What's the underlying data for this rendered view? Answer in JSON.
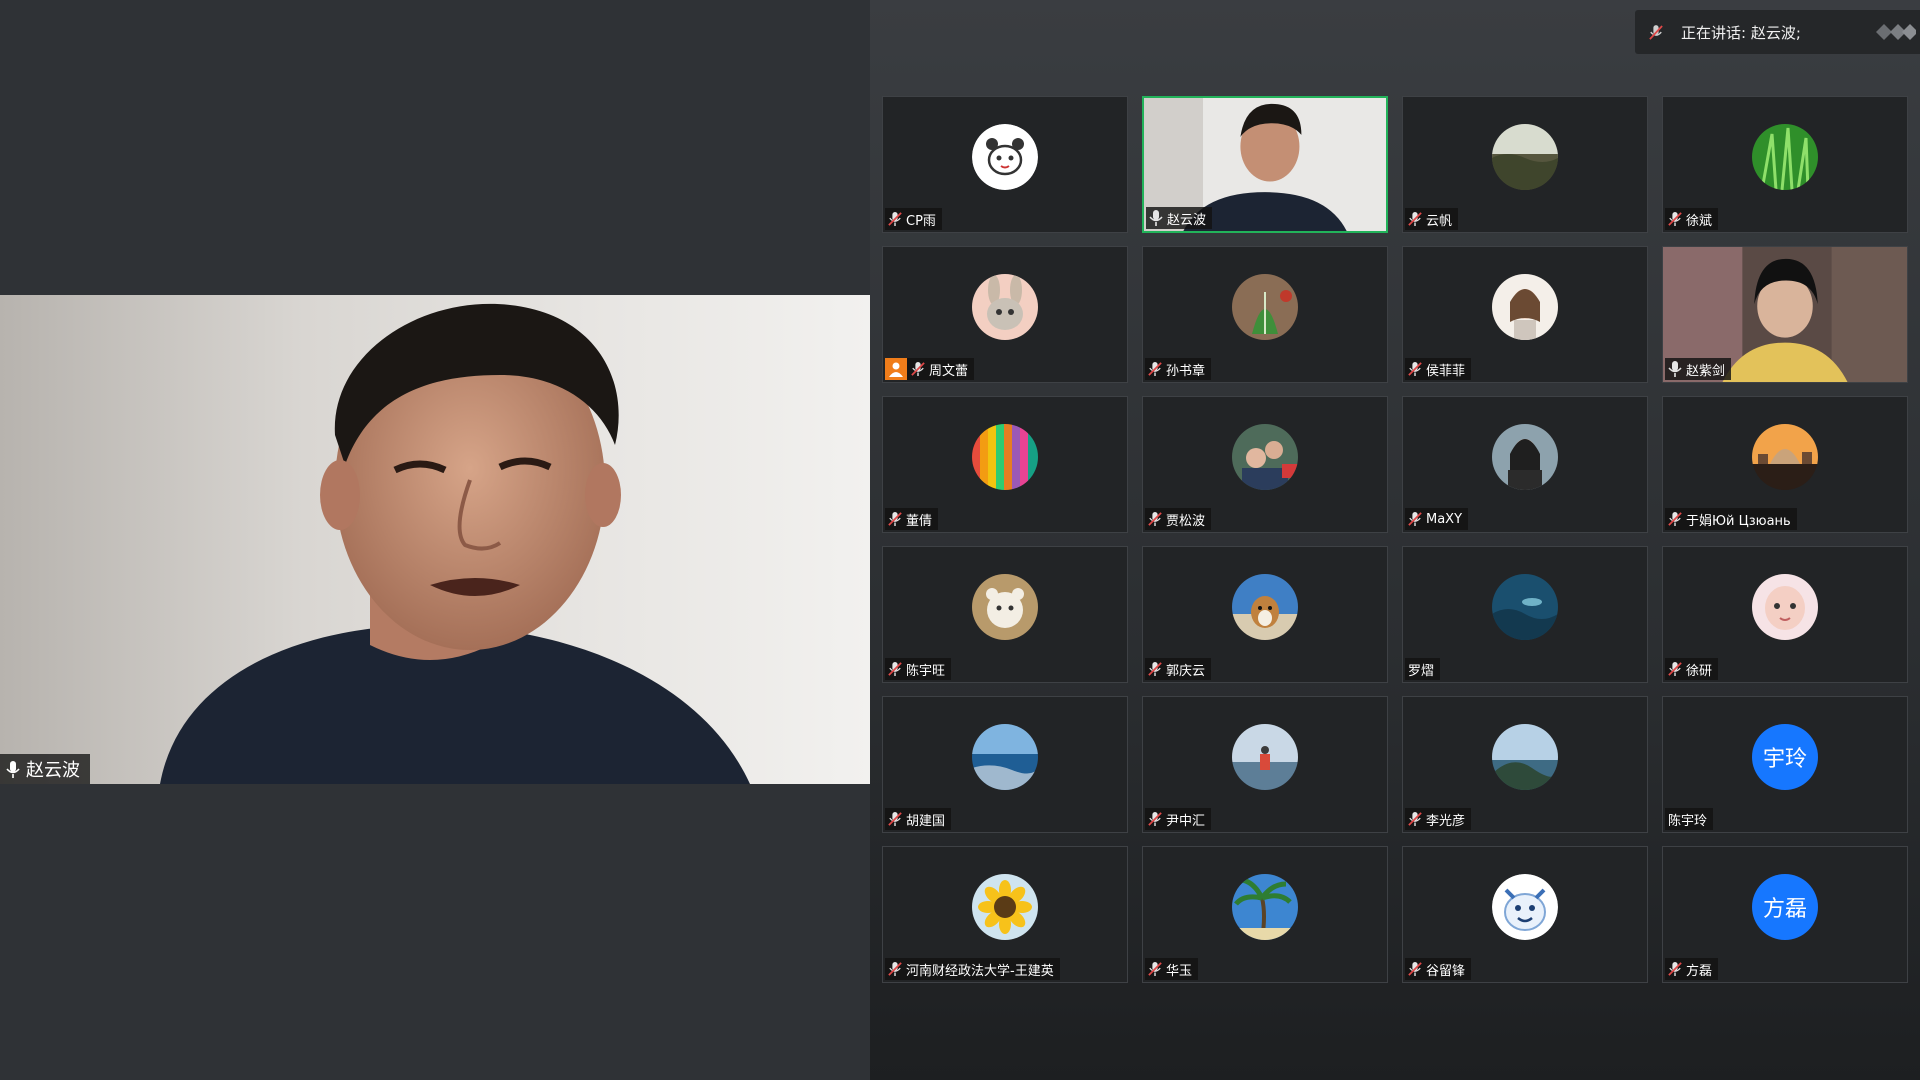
{
  "app": {
    "active_speaker_name": "赵云波"
  },
  "banner": {
    "speaking_label": "正在讲话: 赵云波;"
  },
  "colors": {
    "active_border": "#22b35a",
    "host_badge": "#f07d1a",
    "initials_avatar": "#1677ff",
    "muted_mic": "#e0e0e0"
  },
  "participants": [
    {
      "name": "CP雨",
      "muted": true,
      "avatar": "panda-icon",
      "video": false
    },
    {
      "name": "赵云波",
      "muted": false,
      "avatar": "video",
      "video": true,
      "active": true
    },
    {
      "name": "云帆",
      "muted": true,
      "avatar": "landscape",
      "video": false
    },
    {
      "name": "徐斌",
      "muted": true,
      "avatar": "grass",
      "video": false
    },
    {
      "name": "周文蕾",
      "muted": true,
      "avatar": "rabbit",
      "video": false,
      "host": true
    },
    {
      "name": "孙书章",
      "muted": true,
      "avatar": "leaf",
      "video": false
    },
    {
      "name": "侯菲菲",
      "muted": true,
      "avatar": "girl-drawing",
      "video": false
    },
    {
      "name": "赵紫剑",
      "muted": false,
      "avatar": "video2",
      "video": true
    },
    {
      "name": "董倩",
      "muted": true,
      "avatar": "stripes",
      "video": false
    },
    {
      "name": "贾松波",
      "muted": true,
      "avatar": "family",
      "video": false
    },
    {
      "name": "MaXY",
      "muted": true,
      "avatar": "portrait",
      "video": false
    },
    {
      "name": "于娟Юй Цзюань",
      "muted": true,
      "avatar": "city",
      "video": false
    },
    {
      "name": "陈宇旺",
      "muted": true,
      "avatar": "bear",
      "video": false
    },
    {
      "name": "郭庆云",
      "muted": true,
      "avatar": "dog",
      "video": false
    },
    {
      "name": "罗熠",
      "muted": false,
      "no_mic": true,
      "avatar": "underwater",
      "video": false
    },
    {
      "name": "徐研",
      "muted": true,
      "avatar": "baby",
      "video": false
    },
    {
      "name": "胡建国",
      "muted": true,
      "avatar": "sea",
      "video": false
    },
    {
      "name": "尹中汇",
      "muted": true,
      "avatar": "boat",
      "video": false
    },
    {
      "name": "李光彦",
      "muted": true,
      "avatar": "coast",
      "video": false
    },
    {
      "name": "陈宇玲",
      "muted": false,
      "no_mic": true,
      "avatar": "initials",
      "initials": "宇玲",
      "video": false
    },
    {
      "name": "河南财经政法大学-王建英",
      "muted": true,
      "avatar": "sunflower",
      "video": false
    },
    {
      "name": "华玉",
      "muted": true,
      "avatar": "palm",
      "video": false
    },
    {
      "name": "谷留锋",
      "muted": true,
      "avatar": "cartoon",
      "video": false
    },
    {
      "name": "方磊",
      "muted": true,
      "avatar": "initials",
      "initials": "方磊",
      "video": false
    }
  ]
}
